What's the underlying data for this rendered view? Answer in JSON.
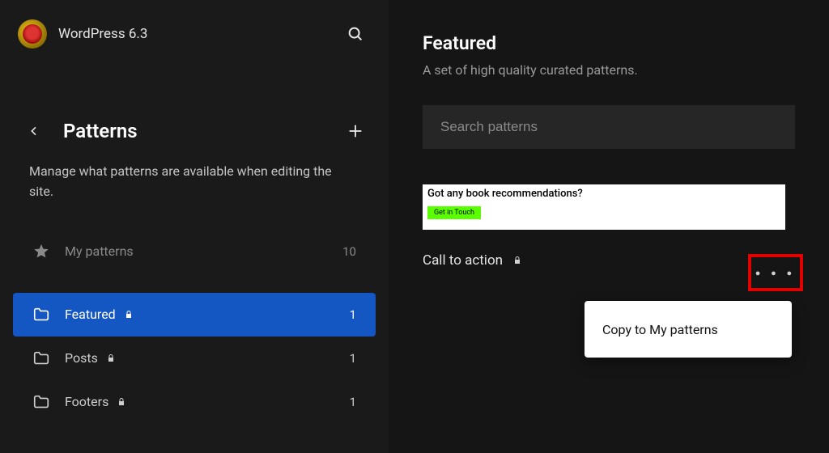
{
  "header": {
    "site_title": "WordPress 6.3"
  },
  "patterns_panel": {
    "title": "Patterns",
    "description": "Manage what patterns are available when editing the site."
  },
  "nav": {
    "my_patterns": {
      "label": "My patterns",
      "count": "10"
    },
    "items": [
      {
        "label": "Featured",
        "count": "1",
        "locked": true,
        "active": true
      },
      {
        "label": "Posts",
        "count": "1",
        "locked": true,
        "active": false
      },
      {
        "label": "Footers",
        "count": "1",
        "locked": true,
        "active": false
      }
    ]
  },
  "main": {
    "title": "Featured",
    "subtitle": "A set of high quality curated patterns.",
    "search_placeholder": "Search patterns"
  },
  "preview": {
    "heading": "Got any book recommendations?",
    "button": "Get in Touch"
  },
  "pattern_item": {
    "name": "Call to action"
  },
  "dropdown": {
    "copy": "Copy to My patterns"
  }
}
